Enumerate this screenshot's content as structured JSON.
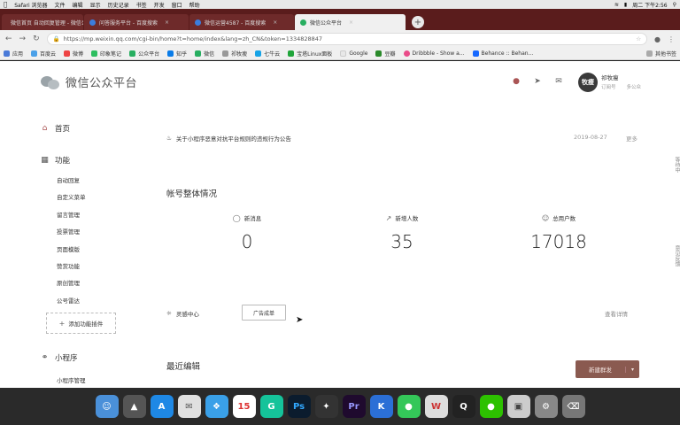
{
  "menubar": {
    "apple": "",
    "items": [
      "Safari 浏览器",
      "文件",
      "编辑",
      "显示",
      "历史记录",
      "书签",
      "开发",
      "窗口",
      "帮助"
    ],
    "status_time": "周二 下午2:56"
  },
  "tabs": [
    {
      "label": "微信首页 自动回复管理 - 微信公众平台",
      "active": false
    },
    {
      "label": "问答服务平台 - 百度搜索",
      "active": false
    },
    {
      "label": "微信运营4587 - 百度搜索",
      "active": false
    },
    {
      "label": "微信公众平台",
      "active": true
    }
  ],
  "address": {
    "url": "https://mp.weixin.qq.com/cgi-bin/home?t=home/index&lang=zh_CN&token=1334828847"
  },
  "bookmarks": {
    "items": [
      "应用",
      "百度云",
      "微博",
      "印象笔记",
      "公众平台",
      "知乎",
      "微信",
      "祁牧瘦",
      "七牛云",
      "宝塔Linux面板",
      "Google",
      "豆瓣",
      "Dribbble - Show a...",
      "Behance :: Behan..."
    ],
    "other": "其他书签"
  },
  "header": {
    "logo_text": "微信公众平台",
    "user_name": "祁牧瘦",
    "user_links": [
      "订阅号",
      "多公众"
    ],
    "avatar_text": "牧瘦",
    "icons": [
      "notification-icon",
      "send-icon",
      "mail-icon"
    ]
  },
  "sidebar": {
    "home": "首页",
    "feature": "功能",
    "feature_items": [
      "自动回复",
      "自定义菜单",
      "留言管理",
      "投票管理",
      "页面模版",
      "赞赏功能",
      "原创管理",
      "公号雷达"
    ],
    "add_plugin": "添加功能插件",
    "mini_program": "小程序",
    "mini_items": [
      "小程序管理"
    ]
  },
  "main": {
    "notice": {
      "text": "关于小程序恶意对抗平台规则的违规行为公告",
      "date": "2019-08-27",
      "more": "更多"
    },
    "account_title": "帐号整体情况",
    "stats": [
      {
        "label": "新消息",
        "value": "0",
        "icon": "chat-icon"
      },
      {
        "label": "新增人数",
        "value": "35",
        "icon": "trend-icon"
      },
      {
        "label": "总用户数",
        "value": "17018",
        "icon": "user-icon"
      }
    ],
    "inspiration": {
      "label": "灵感中心",
      "button": "广告成单",
      "details": "查看详情"
    },
    "recent_title": "最近编辑",
    "new_post": "新建群发"
  },
  "right_hints": [
    "等待中",
    "意见反馈"
  ],
  "dock": {
    "apps": [
      "Finder",
      "Launchpad",
      "App Store",
      "Mail",
      "Safari",
      "Calendar",
      "Grammarly",
      "Photoshop",
      "Final Cut",
      "Premiere",
      "Keynote",
      "Messages",
      "WPS",
      "QQ",
      "WeChat",
      "Preview",
      "Disk Utility",
      "Trash"
    ]
  },
  "colors": {
    "tabbar": "#5a1c1c",
    "new_post_button": "#8a5a50",
    "dock_bg": "#2a2a2a"
  }
}
